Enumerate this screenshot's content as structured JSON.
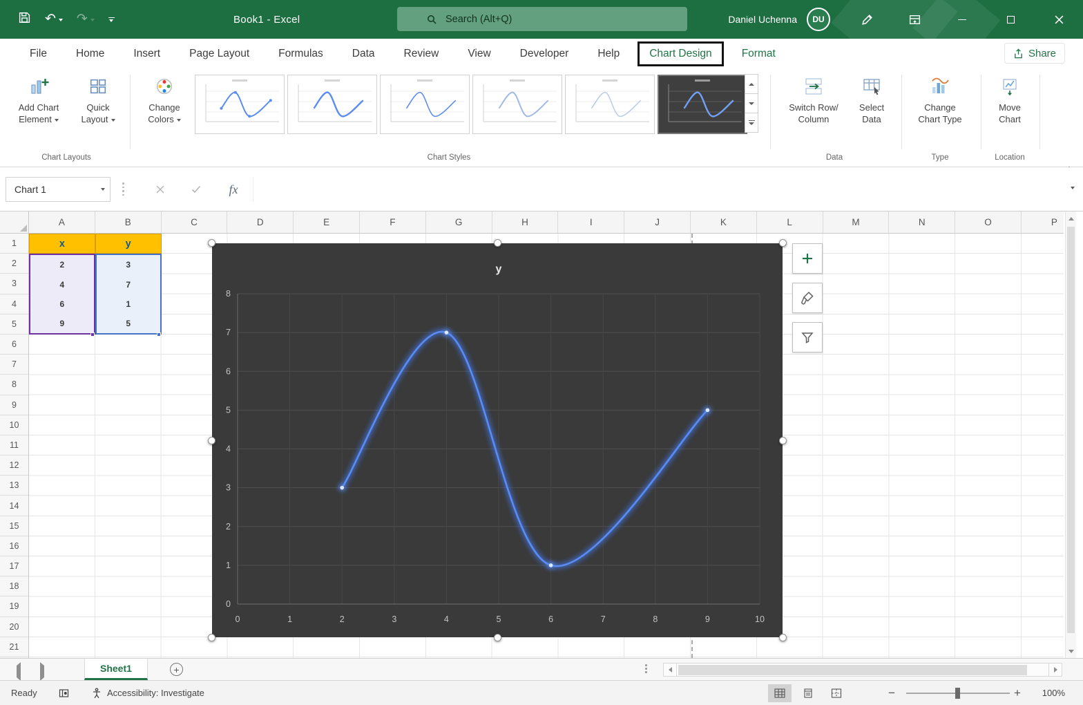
{
  "titlebar": {
    "title": "Book1  -  Excel",
    "search_placeholder": "Search (Alt+Q)",
    "user_name": "Daniel Uchenna",
    "user_initials": "DU"
  },
  "ribbon": {
    "tabs": [
      "File",
      "Home",
      "Insert",
      "Page Layout",
      "Formulas",
      "Data",
      "Review",
      "View",
      "Developer",
      "Help",
      "Chart Design",
      "Format"
    ],
    "active_tab": "Chart Design",
    "contextual_tabs": [
      "Chart Design",
      "Format"
    ],
    "share_label": "Share",
    "buttons": {
      "add_chart_element": {
        "line1": "Add Chart",
        "line2": "Element"
      },
      "quick_layout": {
        "line1": "Quick",
        "line2": "Layout"
      },
      "change_colors": {
        "line1": "Change",
        "line2": "Colors"
      },
      "switch_row_column": {
        "line1": "Switch Row/",
        "line2": "Column"
      },
      "select_data": {
        "line1": "Select",
        "line2": "Data"
      },
      "change_chart_type": {
        "line1": "Change",
        "line2": "Chart Type"
      },
      "move_chart": {
        "line1": "Move",
        "line2": "Chart"
      }
    },
    "group_labels": {
      "chart_layouts": "Chart Layouts",
      "chart_styles": "Chart Styles",
      "data": "Data",
      "type": "Type",
      "location": "Location"
    },
    "styles_gallery": {
      "count": 6,
      "selected_index": 6
    }
  },
  "formula_bar": {
    "name_box_value": "Chart 1",
    "fx_label": "fx"
  },
  "grid": {
    "column_headers": [
      "A",
      "B",
      "C",
      "D",
      "E",
      "F",
      "G",
      "H",
      "I",
      "J",
      "K",
      "L",
      "M",
      "N",
      "O",
      "P"
    ],
    "row_headers": [
      "1",
      "2",
      "3",
      "4",
      "5",
      "6",
      "7",
      "8",
      "9",
      "10",
      "11",
      "12",
      "13",
      "14",
      "15",
      "16",
      "17",
      "18",
      "19",
      "20",
      "21"
    ]
  },
  "table": {
    "header_x": "x",
    "header_y": "y",
    "x_values": [
      "2",
      "4",
      "6",
      "9"
    ],
    "y_values": [
      "3",
      "7",
      "1",
      "5"
    ]
  },
  "chart_data": {
    "type": "line",
    "title": "y",
    "x": [
      2,
      4,
      6,
      9
    ],
    "y": [
      3,
      7,
      1,
      5
    ],
    "xlim": [
      0,
      10
    ],
    "ylim": [
      0,
      8
    ],
    "x_ticks": [
      0,
      1,
      2,
      3,
      4,
      5,
      6,
      7,
      8,
      9,
      10
    ],
    "y_ticks": [
      0,
      1,
      2,
      3,
      4,
      5,
      6,
      7,
      8
    ],
    "grid": true,
    "legend": false,
    "theme": "dark",
    "series_color": "#5b8cf0",
    "background": "#3a3a3a"
  },
  "sheet_bar": {
    "active_tab": "Sheet1"
  },
  "status_bar": {
    "mode": "Ready",
    "accessibility": "Accessibility: Investigate",
    "zoom": "100%"
  }
}
